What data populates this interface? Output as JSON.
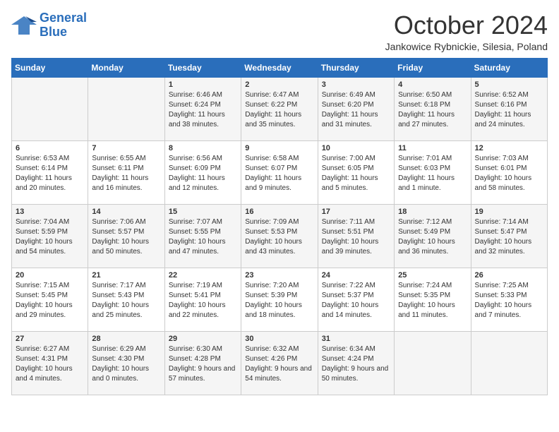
{
  "logo": {
    "line1": "General",
    "line2": "Blue"
  },
  "title": "October 2024",
  "subtitle": "Jankowice Rybnickie, Silesia, Poland",
  "headers": [
    "Sunday",
    "Monday",
    "Tuesday",
    "Wednesday",
    "Thursday",
    "Friday",
    "Saturday"
  ],
  "weeks": [
    [
      {
        "day": "",
        "info": ""
      },
      {
        "day": "",
        "info": ""
      },
      {
        "day": "1",
        "info": "Sunrise: 6:46 AM\nSunset: 6:24 PM\nDaylight: 11 hours and 38 minutes."
      },
      {
        "day": "2",
        "info": "Sunrise: 6:47 AM\nSunset: 6:22 PM\nDaylight: 11 hours and 35 minutes."
      },
      {
        "day": "3",
        "info": "Sunrise: 6:49 AM\nSunset: 6:20 PM\nDaylight: 11 hours and 31 minutes."
      },
      {
        "day": "4",
        "info": "Sunrise: 6:50 AM\nSunset: 6:18 PM\nDaylight: 11 hours and 27 minutes."
      },
      {
        "day": "5",
        "info": "Sunrise: 6:52 AM\nSunset: 6:16 PM\nDaylight: 11 hours and 24 minutes."
      }
    ],
    [
      {
        "day": "6",
        "info": "Sunrise: 6:53 AM\nSunset: 6:14 PM\nDaylight: 11 hours and 20 minutes."
      },
      {
        "day": "7",
        "info": "Sunrise: 6:55 AM\nSunset: 6:11 PM\nDaylight: 11 hours and 16 minutes."
      },
      {
        "day": "8",
        "info": "Sunrise: 6:56 AM\nSunset: 6:09 PM\nDaylight: 11 hours and 12 minutes."
      },
      {
        "day": "9",
        "info": "Sunrise: 6:58 AM\nSunset: 6:07 PM\nDaylight: 11 hours and 9 minutes."
      },
      {
        "day": "10",
        "info": "Sunrise: 7:00 AM\nSunset: 6:05 PM\nDaylight: 11 hours and 5 minutes."
      },
      {
        "day": "11",
        "info": "Sunrise: 7:01 AM\nSunset: 6:03 PM\nDaylight: 11 hours and 1 minute."
      },
      {
        "day": "12",
        "info": "Sunrise: 7:03 AM\nSunset: 6:01 PM\nDaylight: 10 hours and 58 minutes."
      }
    ],
    [
      {
        "day": "13",
        "info": "Sunrise: 7:04 AM\nSunset: 5:59 PM\nDaylight: 10 hours and 54 minutes."
      },
      {
        "day": "14",
        "info": "Sunrise: 7:06 AM\nSunset: 5:57 PM\nDaylight: 10 hours and 50 minutes."
      },
      {
        "day": "15",
        "info": "Sunrise: 7:07 AM\nSunset: 5:55 PM\nDaylight: 10 hours and 47 minutes."
      },
      {
        "day": "16",
        "info": "Sunrise: 7:09 AM\nSunset: 5:53 PM\nDaylight: 10 hours and 43 minutes."
      },
      {
        "day": "17",
        "info": "Sunrise: 7:11 AM\nSunset: 5:51 PM\nDaylight: 10 hours and 39 minutes."
      },
      {
        "day": "18",
        "info": "Sunrise: 7:12 AM\nSunset: 5:49 PM\nDaylight: 10 hours and 36 minutes."
      },
      {
        "day": "19",
        "info": "Sunrise: 7:14 AM\nSunset: 5:47 PM\nDaylight: 10 hours and 32 minutes."
      }
    ],
    [
      {
        "day": "20",
        "info": "Sunrise: 7:15 AM\nSunset: 5:45 PM\nDaylight: 10 hours and 29 minutes."
      },
      {
        "day": "21",
        "info": "Sunrise: 7:17 AM\nSunset: 5:43 PM\nDaylight: 10 hours and 25 minutes."
      },
      {
        "day": "22",
        "info": "Sunrise: 7:19 AM\nSunset: 5:41 PM\nDaylight: 10 hours and 22 minutes."
      },
      {
        "day": "23",
        "info": "Sunrise: 7:20 AM\nSunset: 5:39 PM\nDaylight: 10 hours and 18 minutes."
      },
      {
        "day": "24",
        "info": "Sunrise: 7:22 AM\nSunset: 5:37 PM\nDaylight: 10 hours and 14 minutes."
      },
      {
        "day": "25",
        "info": "Sunrise: 7:24 AM\nSunset: 5:35 PM\nDaylight: 10 hours and 11 minutes."
      },
      {
        "day": "26",
        "info": "Sunrise: 7:25 AM\nSunset: 5:33 PM\nDaylight: 10 hours and 7 minutes."
      }
    ],
    [
      {
        "day": "27",
        "info": "Sunrise: 6:27 AM\nSunset: 4:31 PM\nDaylight: 10 hours and 4 minutes."
      },
      {
        "day": "28",
        "info": "Sunrise: 6:29 AM\nSunset: 4:30 PM\nDaylight: 10 hours and 0 minutes."
      },
      {
        "day": "29",
        "info": "Sunrise: 6:30 AM\nSunset: 4:28 PM\nDaylight: 9 hours and 57 minutes."
      },
      {
        "day": "30",
        "info": "Sunrise: 6:32 AM\nSunset: 4:26 PM\nDaylight: 9 hours and 54 minutes."
      },
      {
        "day": "31",
        "info": "Sunrise: 6:34 AM\nSunset: 4:24 PM\nDaylight: 9 hours and 50 minutes."
      },
      {
        "day": "",
        "info": ""
      },
      {
        "day": "",
        "info": ""
      }
    ]
  ]
}
